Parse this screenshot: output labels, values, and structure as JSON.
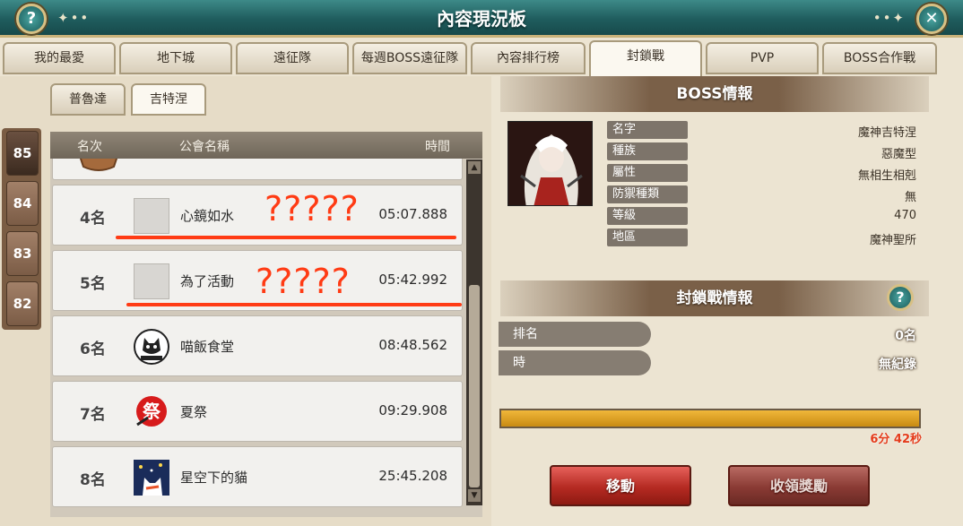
{
  "window": {
    "title": "內容現況板"
  },
  "tabs": [
    {
      "label": "我的最愛"
    },
    {
      "label": "地下城"
    },
    {
      "label": "遠征隊"
    },
    {
      "label": "每週BOSS遠征隊"
    },
    {
      "label": "內容排行榜"
    },
    {
      "label": "封鎖戰"
    },
    {
      "label": "PVP"
    },
    {
      "label": "BOSS合作戰"
    }
  ],
  "subtabs": [
    {
      "label": "普魯達"
    },
    {
      "label": "吉特涅"
    }
  ],
  "levels": [
    "85",
    "84",
    "83",
    "82"
  ],
  "list": {
    "headers": {
      "rank": "名次",
      "guild": "公會名稱",
      "time": "時間"
    },
    "rows": [
      {
        "rank": "4名",
        "guild": "心鏡如水",
        "time": "05:07.888",
        "annotation": "?????"
      },
      {
        "rank": "5名",
        "guild": "為了活動",
        "time": "05:42.992",
        "annotation": "?????"
      },
      {
        "rank": "6名",
        "guild": "喵飯食堂",
        "time": "08:48.562"
      },
      {
        "rank": "7名",
        "guild": "夏祭",
        "time": "09:29.908"
      },
      {
        "rank": "8名",
        "guild": "星空下的貓",
        "time": "25:45.208"
      }
    ],
    "emblem_text": {
      "matsuri": "祭"
    }
  },
  "boss": {
    "heading": "BOSS情報",
    "fields": [
      {
        "label": "名字",
        "value": "魔神吉特涅"
      },
      {
        "label": "種族",
        "value": "惡魔型"
      },
      {
        "label": "屬性",
        "value": "無相生相剋"
      },
      {
        "label": "防禦種類",
        "value": "無"
      },
      {
        "label": "等級",
        "value": "470"
      },
      {
        "label": "地區",
        "value": "魔神聖所"
      }
    ]
  },
  "seal": {
    "heading": "封鎖戰情報",
    "rank_label": "排名",
    "rank_value": "0名",
    "time_label": "時",
    "time_value": "無紀錄",
    "progress_text": "6分 42秒",
    "progress_fraction": 1.0
  },
  "buttons": {
    "move": "移動",
    "claim": "收領獎勵"
  },
  "icons": {
    "help": "?",
    "close": "✕"
  }
}
